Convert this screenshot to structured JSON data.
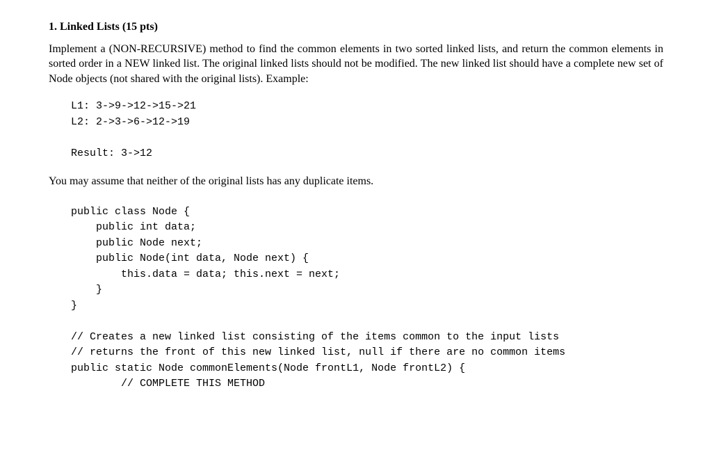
{
  "heading": "1. Linked Lists (15 pts)",
  "paragraph": "Implement a (NON-RECURSIVE) method to find the common elements in two sorted linked lists, and return the common elements in sorted order in a NEW linked list. The original linked lists should not be modified. The new linked list should have a complete new set of Node objects (not shared with the original lists). Example:",
  "example": "L1: 3->9->12->15->21\nL2: 2->3->6->12->19\n\nResult: 3->12",
  "assume": "You may assume that neither of the original lists has any duplicate items.",
  "code": "public class Node {\n    public int data;\n    public Node next;\n    public Node(int data, Node next) {\n        this.data = data; this.next = next;\n    }\n}\n\n// Creates a new linked list consisting of the items common to the input lists\n// returns the front of this new linked list, null if there are no common items\npublic static Node commonElements(Node frontL1, Node frontL2) {\n        // COMPLETE THIS METHOD"
}
